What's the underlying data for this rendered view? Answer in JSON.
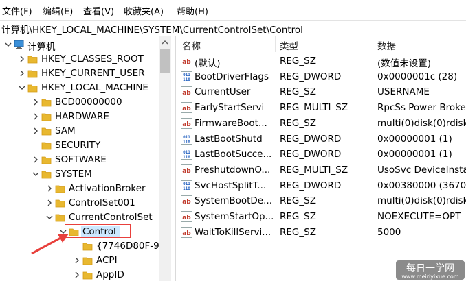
{
  "menu": [
    {
      "label": "文件(F)"
    },
    {
      "label": "编辑(E)"
    },
    {
      "label": "查看(V)"
    },
    {
      "label": "收藏夹(A)"
    },
    {
      "label": "帮助(H)"
    }
  ],
  "address": "计算机\\HKEY_LOCAL_MACHINE\\SYSTEM\\CurrentControlSet\\Control",
  "tree": [
    {
      "label": "计算机",
      "expanded": true
    },
    {
      "label": "HKEY_CLASSES_ROOT"
    },
    {
      "label": "HKEY_CURRENT_USER"
    },
    {
      "label": "HKEY_LOCAL_MACHINE",
      "expanded": true
    },
    {
      "label": "BCD00000000"
    },
    {
      "label": "HARDWARE"
    },
    {
      "label": "SAM"
    },
    {
      "label": "SECURITY"
    },
    {
      "label": "SOFTWARE"
    },
    {
      "label": "SYSTEM",
      "expanded": true
    },
    {
      "label": "ActivationBroker"
    },
    {
      "label": "ControlSet001"
    },
    {
      "label": "CurrentControlSet",
      "expanded": true
    },
    {
      "label": "Control",
      "expanded": true,
      "selected": true
    },
    {
      "label": "{7746D80F-97"
    },
    {
      "label": "ACPI"
    },
    {
      "label": "AppID"
    }
  ],
  "columns": {
    "name": "名称",
    "type": "类型",
    "data": "数据"
  },
  "values": [
    {
      "icon": "string-value-icon",
      "name": "(默认)",
      "type": "REG_SZ",
      "data": "(数值未设置)"
    },
    {
      "icon": "binary-value-icon",
      "name": "BootDriverFlags",
      "type": "REG_DWORD",
      "data": "0x0000001c (28)"
    },
    {
      "icon": "string-value-icon",
      "name": "CurrentUser",
      "type": "REG_SZ",
      "data": "USERNAME"
    },
    {
      "icon": "string-value-icon",
      "name": "EarlyStartServi",
      "type": "REG_MULTI_SZ",
      "data": "RpcSs Power Broke"
    },
    {
      "icon": "string-value-icon",
      "name": "FirmwareBoot...",
      "type": "REG_SZ",
      "data": "multi(0)disk(0)rdisk"
    },
    {
      "icon": "binary-value-icon",
      "name": "LastBootShutd",
      "type": "REG_DWORD",
      "data": "0x00000001 (1)"
    },
    {
      "icon": "binary-value-icon",
      "name": "LastBootSucce...",
      "type": "REG_DWORD",
      "data": "0x00000001 (1)"
    },
    {
      "icon": "string-value-icon",
      "name": "PreshutdownO...",
      "type": "REG_MULTI_SZ",
      "data": "UsoSvc DeviceInsta"
    },
    {
      "icon": "binary-value-icon",
      "name": "SvcHostSplitT...",
      "type": "REG_DWORD",
      "data": "0x00380000 (3670"
    },
    {
      "icon": "string-value-icon",
      "name": "SystemBootDe...",
      "type": "REG_SZ",
      "data": "multi(0)disk(0)rdisk"
    },
    {
      "icon": "string-value-icon",
      "name": "SystemStartOp...",
      "type": "REG_SZ",
      "data": " NOEXECUTE=OPT"
    },
    {
      "icon": "string-value-icon",
      "name": "WaitToKillServi...",
      "type": "REG_SZ",
      "data": "5000"
    }
  ],
  "watermark": {
    "line1": "每日一学网",
    "line2": "www.meiriyixue.com"
  },
  "colors": {
    "folder": "#e8b830",
    "folder_dark": "#d49a14",
    "selected": "#cce8ff",
    "highlight": "#e8403c",
    "string_icon": "#c0392b",
    "binary_icon": "#1f5fbf"
  }
}
